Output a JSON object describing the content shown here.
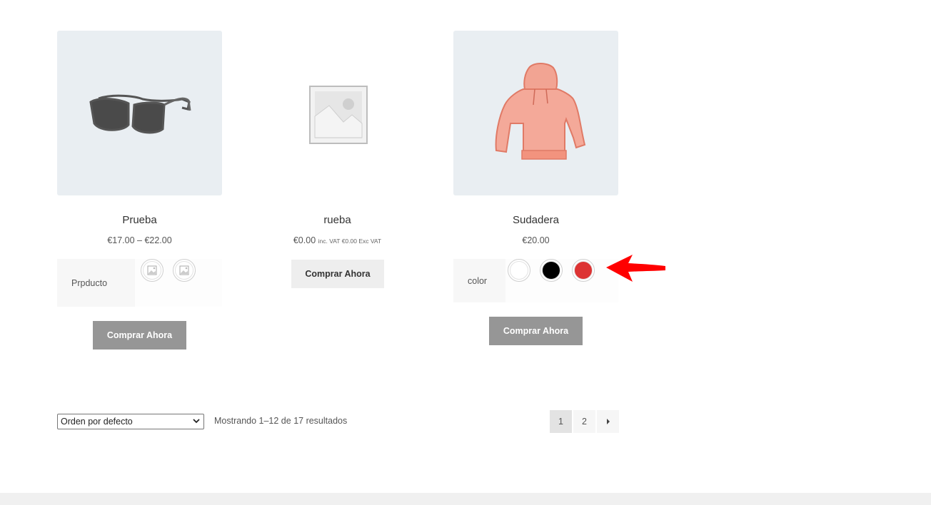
{
  "products": [
    {
      "title": "Prueba",
      "price": "€17.00 – €22.00",
      "attribute_label": "Prpducto",
      "button_label": "Comprar Ahora"
    },
    {
      "title": "rueba",
      "price": "€0.00",
      "price_suffix": "inc. VAT €0.00 Exc VAT",
      "button_label": "Comprar Ahora"
    },
    {
      "title": "Sudadera",
      "price": "€20.00",
      "attribute_label": "color",
      "swatch_colors": [
        "#ffffff",
        "#000000",
        "#dd3333"
      ],
      "button_label": "Comprar Ahora"
    }
  ],
  "toolbar": {
    "sort_selected": "Orden por defecto",
    "result_count": "Mostrando 1–12 de 17 resultados"
  },
  "pagination": {
    "pages": [
      "1",
      "2"
    ],
    "current": "1"
  },
  "icons": {
    "annotation": "red-arrow-icon",
    "next": "next-page-icon",
    "dropdown": "chevron-down-icon"
  }
}
